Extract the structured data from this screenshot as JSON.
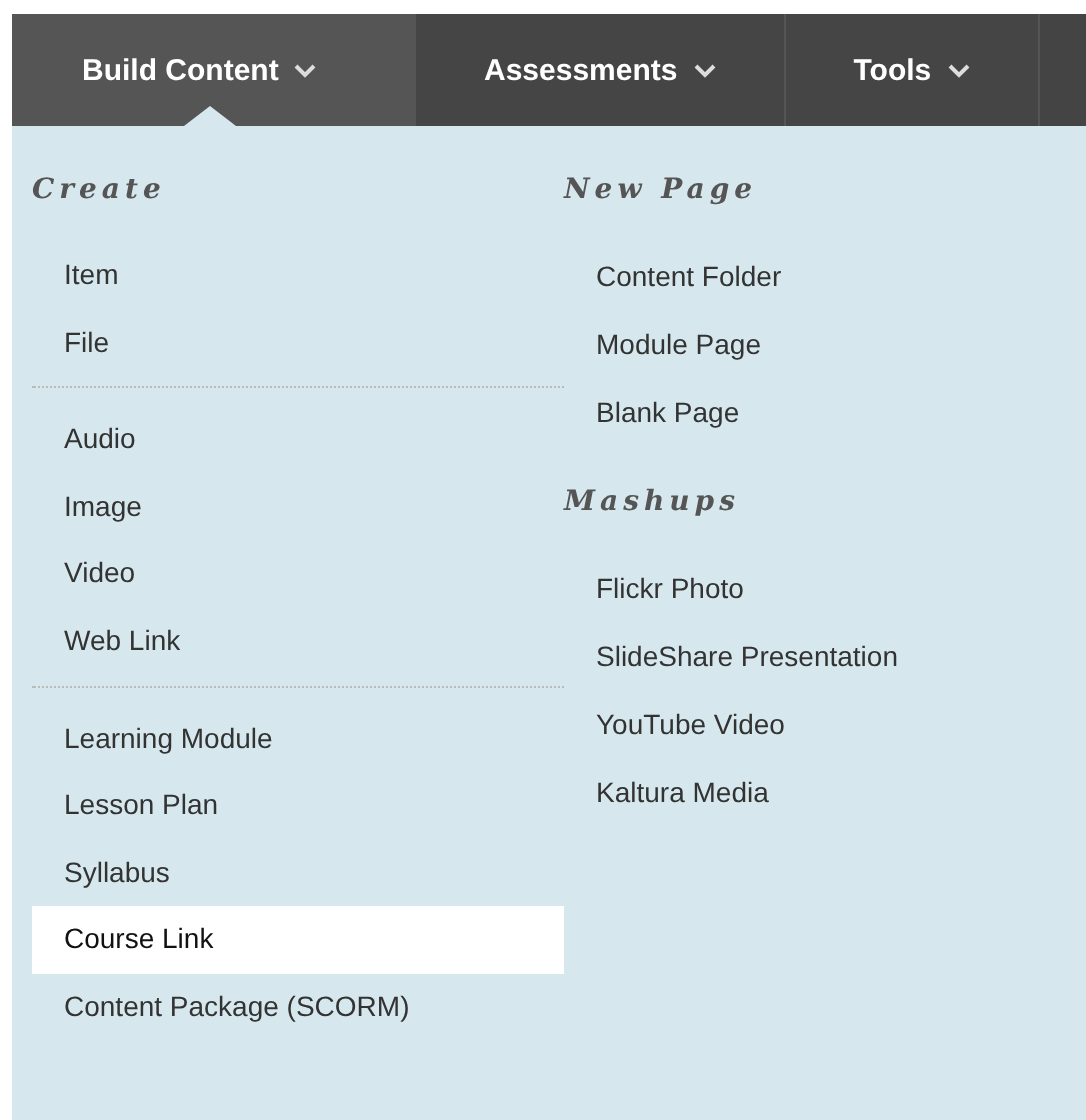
{
  "nav_tabs": [
    {
      "label": "Build Content",
      "selected": true
    },
    {
      "label": "Assessments",
      "selected": false
    },
    {
      "label": "Tools",
      "selected": false
    }
  ],
  "menu": {
    "columns": [
      {
        "sections": [
          {
            "heading": "Create",
            "groups": [
              [
                {
                  "label": "Item",
                  "selected": false
                },
                {
                  "label": "File",
                  "selected": false
                }
              ],
              [
                {
                  "label": "Audio",
                  "selected": false
                },
                {
                  "label": "Image",
                  "selected": false
                },
                {
                  "label": "Video",
                  "selected": false
                },
                {
                  "label": "Web Link",
                  "selected": false
                }
              ],
              [
                {
                  "label": "Learning Module",
                  "selected": false
                },
                {
                  "label": "Lesson Plan",
                  "selected": false
                },
                {
                  "label": "Syllabus",
                  "selected": false
                },
                {
                  "label": "Course Link",
                  "selected": true
                },
                {
                  "label": "Content Package (SCORM)",
                  "selected": false
                }
              ]
            ]
          }
        ]
      },
      {
        "sections": [
          {
            "heading": "New Page",
            "groups": [
              [
                {
                  "label": "Content Folder",
                  "selected": false
                },
                {
                  "label": "Module Page",
                  "selected": false
                },
                {
                  "label": "Blank Page",
                  "selected": false
                }
              ]
            ]
          },
          {
            "heading": "Mashups",
            "groups": [
              [
                {
                  "label": "Flickr Photo",
                  "selected": false
                },
                {
                  "label": "SlideShare Presentation",
                  "selected": false
                },
                {
                  "label": "YouTube Video",
                  "selected": false
                },
                {
                  "label": "Kaltura Media",
                  "selected": false
                }
              ]
            ]
          }
        ]
      }
    ]
  }
}
